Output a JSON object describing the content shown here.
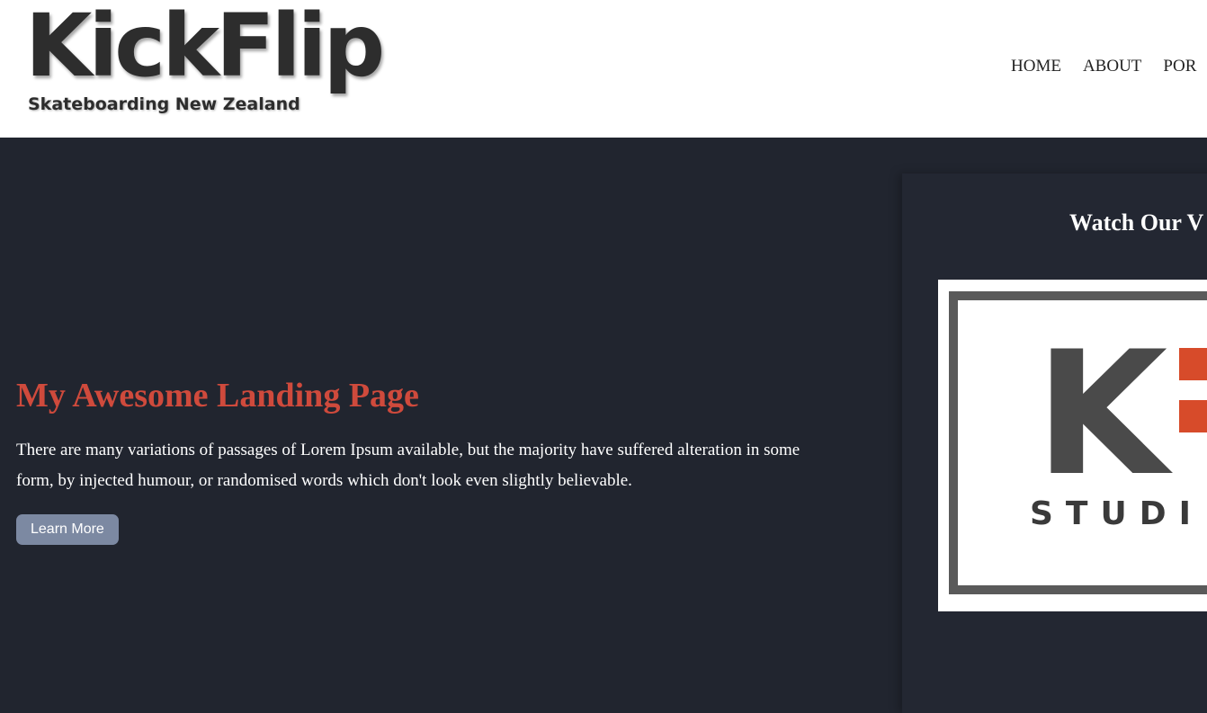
{
  "header": {
    "logo_title": "KickFlip",
    "logo_subtitle": "Skateboarding New Zealand",
    "nav": {
      "home": "HOME",
      "about": "ABOUT",
      "portfolio": "POR"
    }
  },
  "hero": {
    "title": "My Awesome Landing Page",
    "body": "There are many variations of passages of Lorem Ipsum available, but the majority have suffered alteration in some form, by injected humour, or randomised words which don't look even slightly believable.",
    "button_label": "Learn More"
  },
  "video_panel": {
    "title": "Watch Our V",
    "thumbnail_letter": "K",
    "thumbnail_text": "STUDI"
  },
  "colors": {
    "page_background": "#21252f",
    "accent_red": "#cf4a3c",
    "button_background": "#7c89a2",
    "header_background": "#ffffff"
  }
}
